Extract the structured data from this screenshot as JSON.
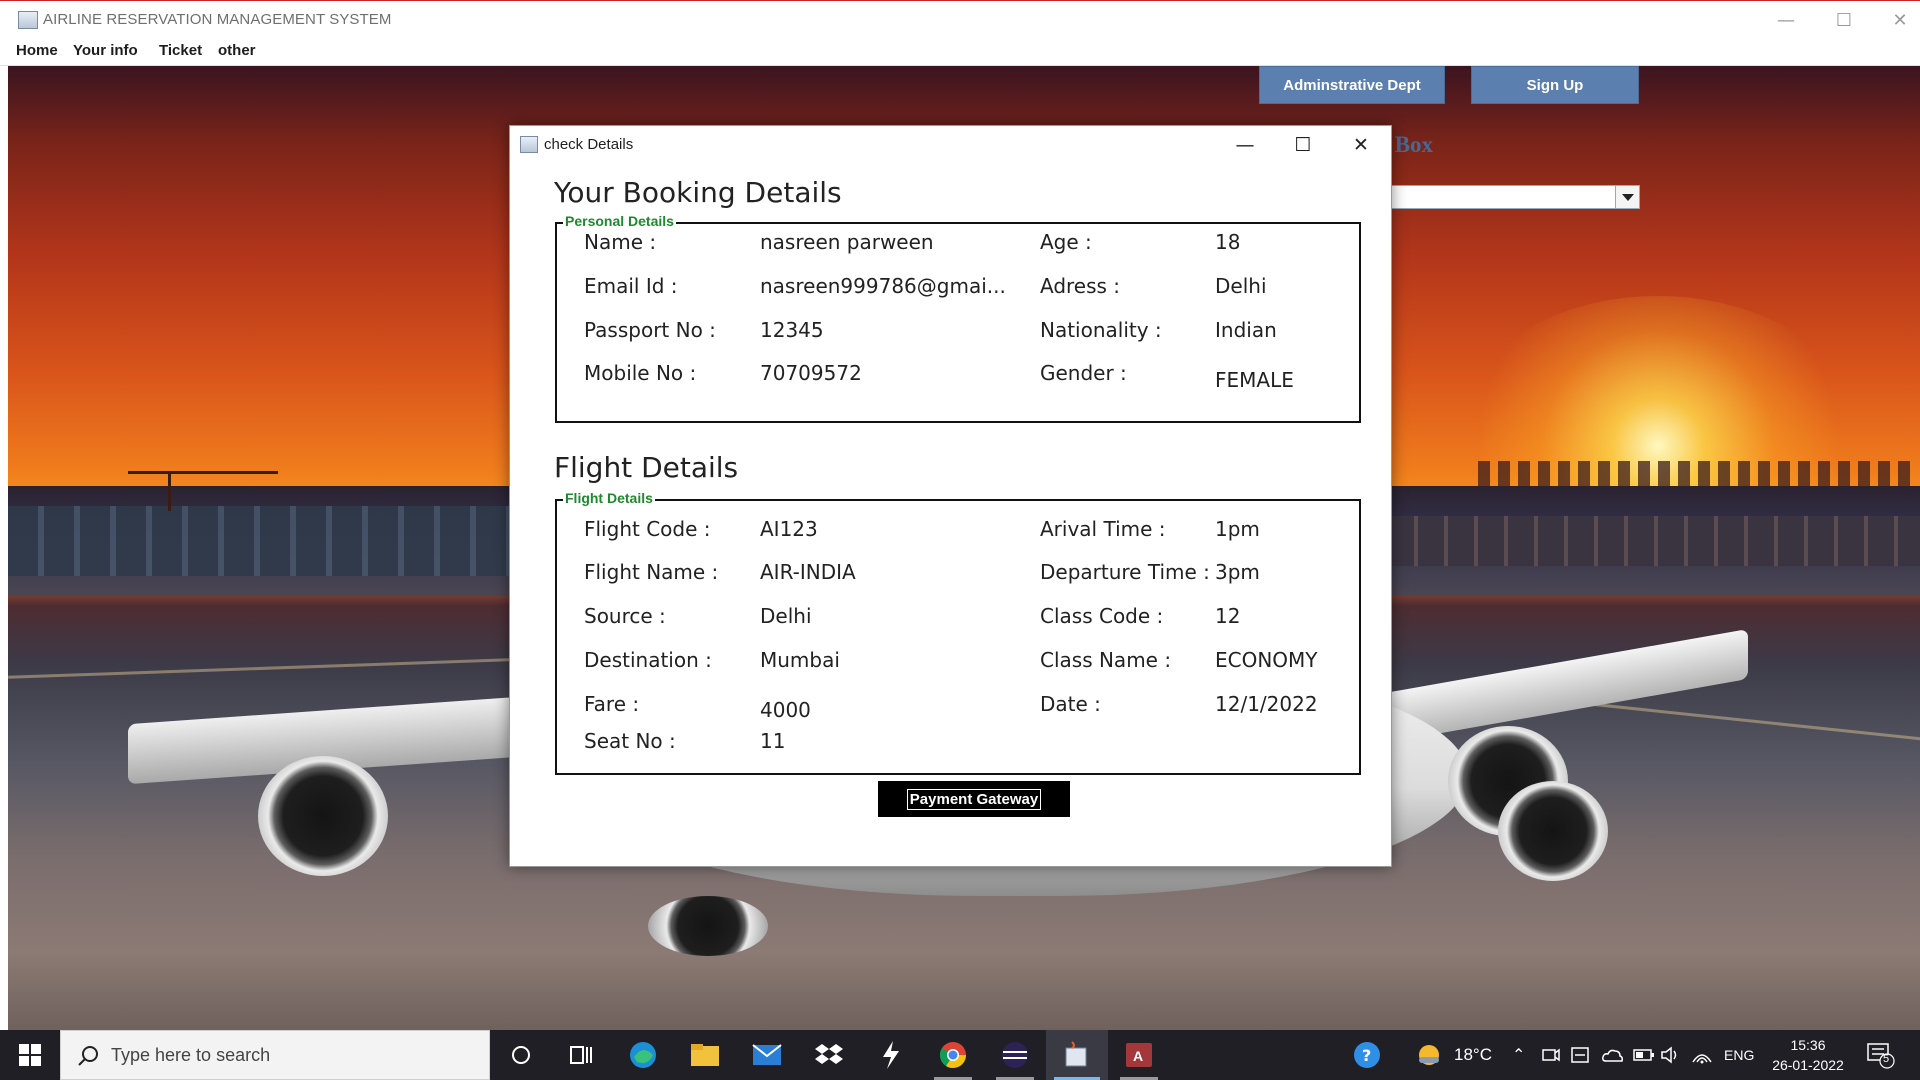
{
  "app": {
    "title": "AIRLINE RESERVATION MANAGEMENT SYSTEM",
    "menu": [
      "Home",
      "Your info",
      "Ticket",
      "other"
    ],
    "buttons": {
      "admin": "Adminstrative Dept",
      "signup": "Sign Up"
    },
    "partial_label": "s Box"
  },
  "dialog": {
    "title": "check Details",
    "booking_heading": "Your Booking Details",
    "personal": {
      "legend": "Personal Details",
      "name_label": "Name :",
      "name_value": "nasreen parween",
      "age_label": "Age :",
      "age_value": "18",
      "email_label": "Email Id :",
      "email_value": "nasreen999786@gmai...",
      "address_label": "Adress :",
      "address_value": "Delhi",
      "passport_label": "Passport No :",
      "passport_value": "12345",
      "nationality_label": "Nationality :",
      "nationality_value": "Indian",
      "mobile_label": "Mobile No :",
      "mobile_value": "70709572",
      "gender_label": "Gender :",
      "gender_value": "FEMALE"
    },
    "flight_heading": "Flight Details",
    "flight": {
      "legend": "Flight Details",
      "code_label": "Flight Code :",
      "code_value": "AI123",
      "arrival_label": "Arival Time :",
      "arrival_value": "1pm",
      "name_label": "Flight Name :",
      "name_value": "AIR-INDIA",
      "departure_label": "Departure Time :",
      "departure_value": "3pm",
      "source_label": "Source :",
      "source_value": "Delhi",
      "class_code_label": "Class Code :",
      "class_code_value": "12",
      "destination_label": "Destination :",
      "destination_value": "Mumbai",
      "class_name_label": "Class Name :",
      "class_name_value": "ECONOMY",
      "fare_label": "Fare :",
      "fare_value": "4000",
      "date_label": "Date :",
      "date_value": "12/1/2022",
      "seat_label": "Seat No :",
      "seat_value": "11"
    },
    "payment_button": "Payment Gateway"
  },
  "taskbar": {
    "search_placeholder": "Type here to search",
    "temperature": "18°C",
    "language": "ENG",
    "time": "15:36",
    "date": "26-01-2022",
    "notification_count": "5"
  },
  "colors": {
    "legend_green": "#1e8a2d",
    "button_blue": "#5b7fae",
    "taskbar": "#1f1f25"
  }
}
